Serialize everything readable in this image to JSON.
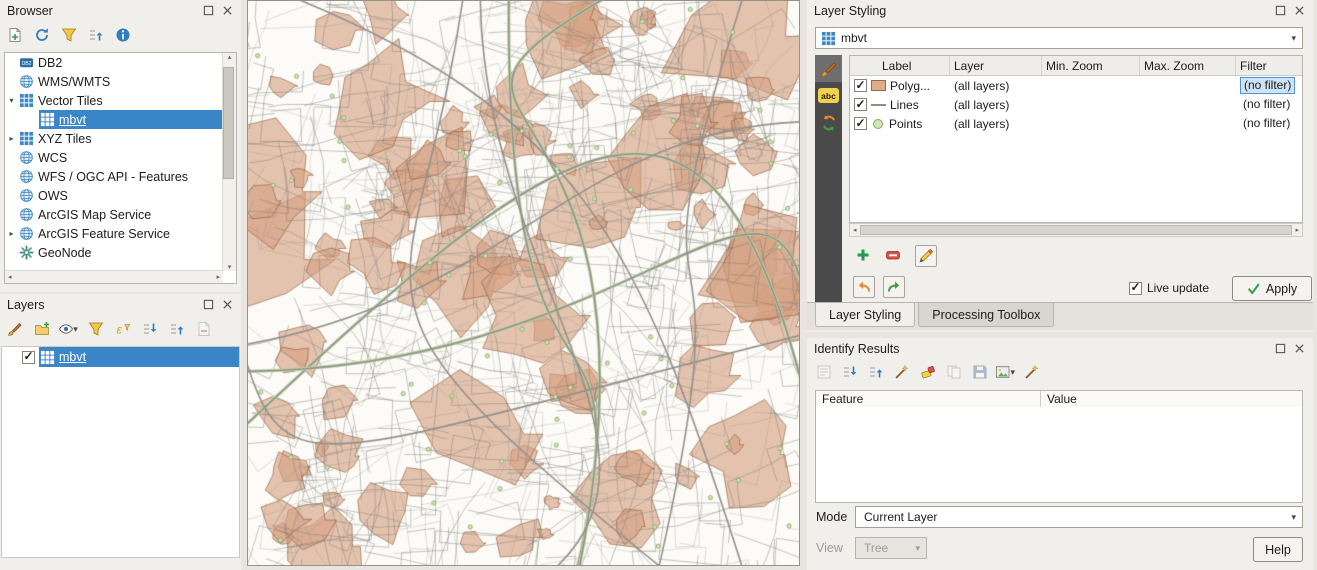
{
  "colors": {
    "selection_blue": "#3a86c8",
    "panel_bg": "#f1efec",
    "dark_toolbar": "#4a4a4a",
    "map_polygon_fill": "#d9a987",
    "map_polygon_stroke": "#9c6a42",
    "map_road": "#94918c",
    "map_point_fill": "#cfe4b8",
    "map_point_stroke": "#84aa62"
  },
  "browser": {
    "title": "Browser",
    "toolbar": [
      {
        "name": "add-layer-icon"
      },
      {
        "name": "refresh-icon"
      },
      {
        "name": "filter-browser-icon"
      },
      {
        "name": "collapse-all-icon"
      },
      {
        "name": "properties-icon"
      }
    ],
    "items": [
      {
        "label": "DB2",
        "icon": "db2-icon"
      },
      {
        "label": "WMS/WMTS",
        "icon": "globe-icon"
      },
      {
        "label": "Vector Tiles",
        "icon": "grid-icon",
        "expanded": true
      },
      {
        "label": "mbvt",
        "icon": "grid-icon",
        "selected": true
      },
      {
        "label": "XYZ Tiles",
        "icon": "grid-icon",
        "expandable": true
      },
      {
        "label": "WCS",
        "icon": "globe-icon"
      },
      {
        "label": "WFS / OGC API - Features",
        "icon": "globe-icon"
      },
      {
        "label": "OWS",
        "icon": "globe-icon"
      },
      {
        "label": "ArcGIS Map Service",
        "icon": "globe-icon"
      },
      {
        "label": "ArcGIS Feature Service",
        "icon": "globe-icon",
        "expandable": true
      },
      {
        "label": "GeoNode",
        "icon": "geonode-icon"
      }
    ]
  },
  "layers": {
    "title": "Layers",
    "toolbar": [
      {
        "name": "open-layer-styling-icon"
      },
      {
        "name": "add-group-icon"
      },
      {
        "name": "manage-map-themes-icon"
      },
      {
        "name": "filter-legend-icon"
      },
      {
        "name": "filter-expression-icon"
      },
      {
        "name": "expand-all-icon"
      },
      {
        "name": "collapse-all-icon"
      },
      {
        "name": "remove-layer-icon"
      }
    ],
    "items": [
      {
        "label": "mbvt",
        "checked": true,
        "selected": true,
        "icon": "grid-icon"
      }
    ]
  },
  "styling": {
    "title": "Layer Styling",
    "layer_selector": {
      "value": "mbvt",
      "icon": "grid-icon"
    },
    "side_toolbar": [
      {
        "name": "symbology-icon",
        "active": true
      },
      {
        "name": "labels-icon",
        "label": "abc"
      },
      {
        "name": "history-icon"
      }
    ],
    "rules_table": {
      "headers": [
        "Label",
        "Layer",
        "Min. Zoom",
        "Max. Zoom",
        "Filter"
      ],
      "rows": [
        {
          "checked": true,
          "swatch": "polygon",
          "label": "Polyg...",
          "layer": "(all layers)",
          "min_zoom": "",
          "max_zoom": "",
          "filter": "(no filter)",
          "filter_selected": true
        },
        {
          "checked": true,
          "swatch": "line",
          "label": "Lines",
          "layer": "(all layers)",
          "min_zoom": "",
          "max_zoom": "",
          "filter": "(no filter)",
          "filter_selected": false
        },
        {
          "checked": true,
          "swatch": "point",
          "label": "Points",
          "layer": "(all layers)",
          "min_zoom": "",
          "max_zoom": "",
          "filter": "(no filter)",
          "filter_selected": false
        }
      ]
    },
    "actions": [
      {
        "name": "add-rule-icon"
      },
      {
        "name": "remove-rule-icon"
      },
      {
        "name": "edit-rule-icon"
      },
      {
        "name": "undo-icon"
      },
      {
        "name": "redo-icon"
      }
    ],
    "live_update": {
      "label": "Live update",
      "checked": true
    },
    "apply_button": "Apply",
    "tabs": [
      {
        "label": "Layer Styling",
        "active": true
      },
      {
        "label": "Processing Toolbox",
        "active": false
      }
    ]
  },
  "identify": {
    "title": "Identify Results",
    "toolbar": [
      {
        "name": "open-form-icon",
        "disabled": true
      },
      {
        "name": "expand-tree-icon"
      },
      {
        "name": "collapse-tree-icon"
      },
      {
        "name": "expand-new-results-icon"
      },
      {
        "name": "clear-results-icon"
      },
      {
        "name": "copy-feature-icon",
        "disabled": true
      },
      {
        "name": "save-results-icon",
        "disabled": true
      },
      {
        "name": "identify-settings-icon"
      },
      {
        "name": "measure-icon"
      }
    ],
    "columns": [
      "Feature",
      "Value"
    ],
    "mode": {
      "label": "Mode",
      "value": "Current Layer"
    },
    "view": {
      "label": "View",
      "value": "Tree",
      "disabled": true
    },
    "help_button": "Help"
  }
}
